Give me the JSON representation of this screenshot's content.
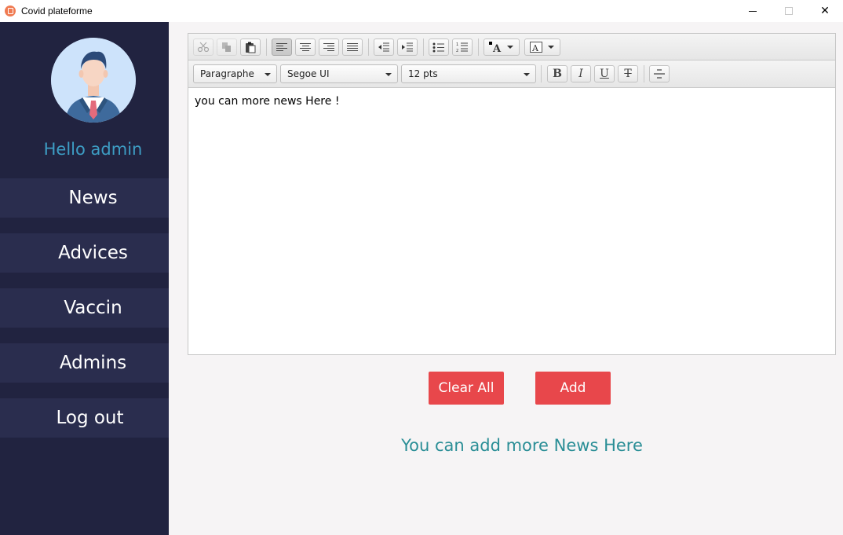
{
  "window": {
    "title": "Covid plateforme",
    "minimize": "–",
    "maximize": "□",
    "close": "✕"
  },
  "sidebar": {
    "greeting": "Hello admin",
    "items": [
      {
        "label": "News"
      },
      {
        "label": "Advices"
      },
      {
        "label": "Vaccin"
      },
      {
        "label": "Admins"
      },
      {
        "label": "Log out"
      }
    ]
  },
  "editor": {
    "paragraph_style": "Paragraphe",
    "font_family": "Segoe UI",
    "font_size": "12 pts",
    "content": "you can more news Here !",
    "format_buttons": {
      "bold": "B",
      "italic": "I",
      "underline": "U",
      "strikethrough": "T"
    }
  },
  "actions": {
    "clear_label": "Clear All",
    "add_label": "Add"
  },
  "hint": "You can add more News Here",
  "colors": {
    "sidebar": "#212340",
    "nav_item": "#2a2d4e",
    "accent_button": "#e8474b",
    "greeting": "#3d9dc4",
    "hint": "#2a8e96"
  }
}
